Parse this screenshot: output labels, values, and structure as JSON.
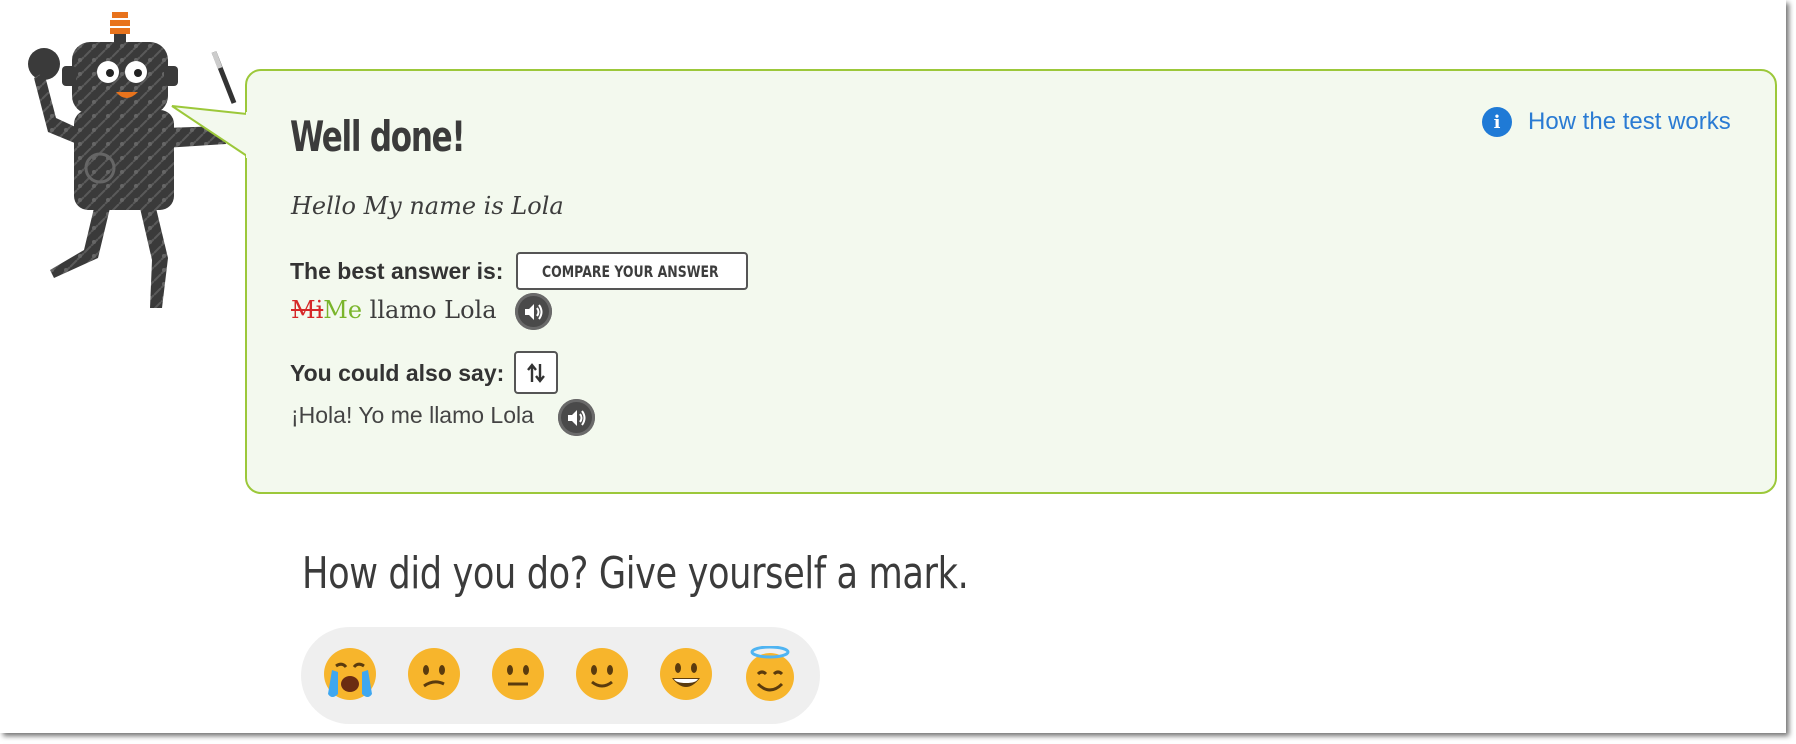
{
  "feedback": {
    "title": "Well done!",
    "prompt": "Hello My name is Lola",
    "best_answer_label": "The best answer is:",
    "compare_button_label": "COMPARE YOUR ANSWER",
    "best_answer": {
      "wrong_word": "Mi",
      "correct_word": "Me",
      "rest": "llamo Lola"
    },
    "also_say_label": "You could also say:",
    "alternative_answer": "¡Hola! Yo me llamo Lola"
  },
  "help_link": {
    "label": "How the test works",
    "icon": "info-icon"
  },
  "rating": {
    "heading": "How did you do? Give yourself a mark.",
    "options": [
      {
        "name": "crying-face-icon"
      },
      {
        "name": "confused-face-icon"
      },
      {
        "name": "neutral-face-icon"
      },
      {
        "name": "slightly-smiling-face-icon"
      },
      {
        "name": "grinning-face-icon"
      },
      {
        "name": "smiling-face-with-halo-icon"
      }
    ]
  },
  "colors": {
    "bubble_background": "#f3f9ee",
    "bubble_border": "#9cc83a",
    "wrong": "#d62828",
    "correct": "#7ab52c",
    "link": "#2a7bd3"
  }
}
